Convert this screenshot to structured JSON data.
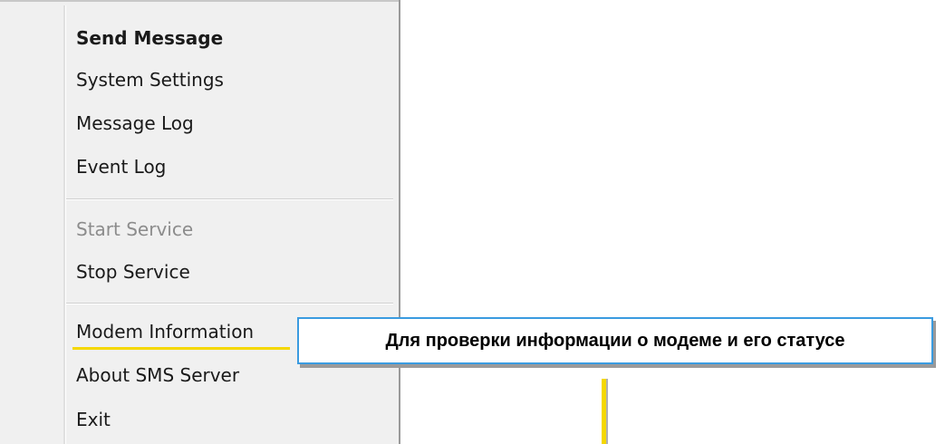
{
  "menu": {
    "items": [
      {
        "label": "Send Message",
        "bold": true
      },
      {
        "label": "System Settings"
      },
      {
        "label": "Message Log"
      },
      {
        "label": "Event Log"
      },
      {
        "label": "Start Service",
        "disabled": true
      },
      {
        "label": "Stop Service"
      },
      {
        "label": "Modem Information"
      },
      {
        "label": "About SMS Server"
      },
      {
        "label": "Exit"
      }
    ]
  },
  "callout": {
    "text": "Для проверки информации о модеме и его статусе"
  },
  "colors": {
    "highlight": "#f5d800",
    "callout_border": "#3a9be0",
    "menu_bg": "#f0f0f0"
  }
}
